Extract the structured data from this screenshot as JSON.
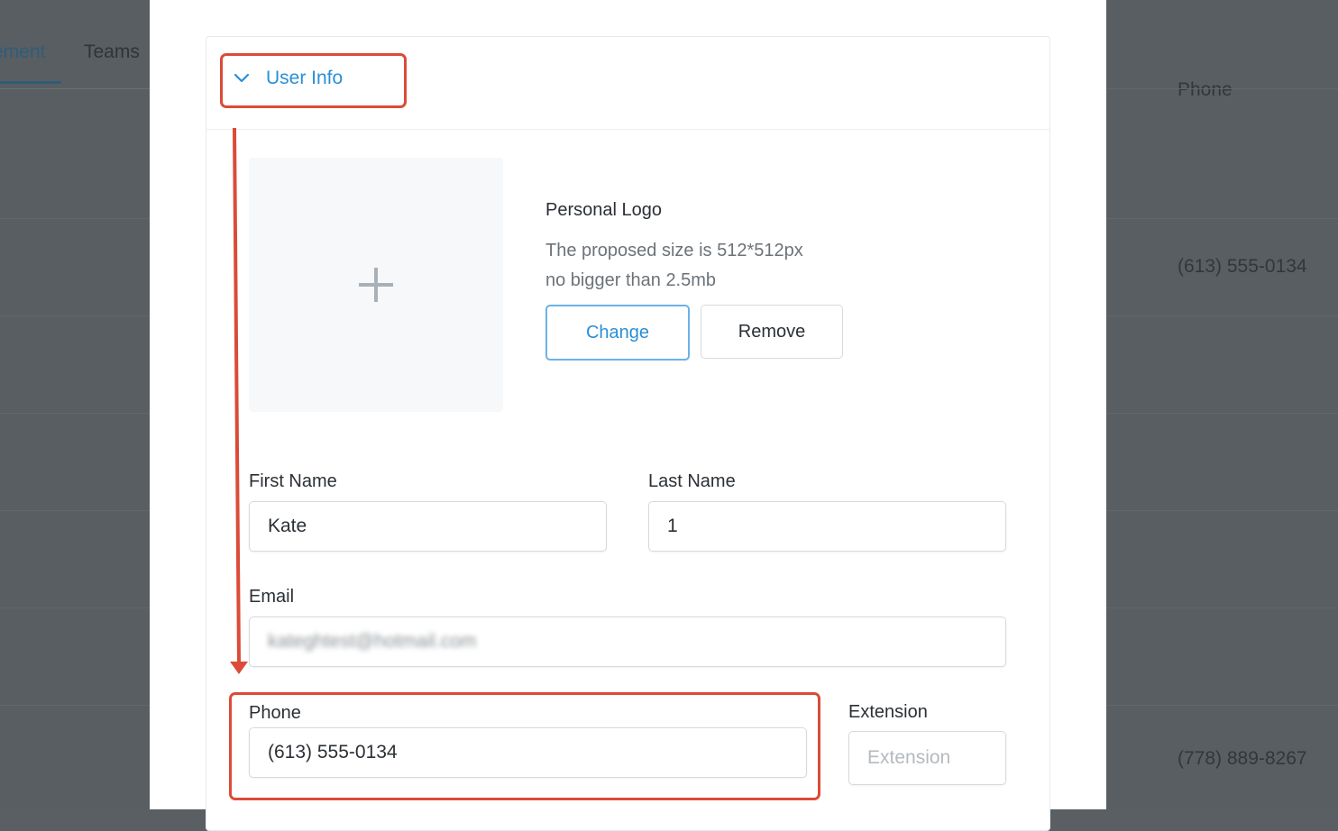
{
  "background": {
    "tabs": [
      {
        "label": "ement"
      },
      {
        "label": "Teams"
      }
    ],
    "column_header": "Phone",
    "phone_values": [
      "(613) 555-0134",
      "(778) 889-8267"
    ]
  },
  "user_info": {
    "section_label": "User Info",
    "logo": {
      "title": "Personal Logo",
      "hint_line1": "The proposed size is 512*512px",
      "hint_line2": "no bigger than 2.5mb",
      "change_label": "Change",
      "remove_label": "Remove",
      "add_icon": "plus-icon"
    },
    "first_name": {
      "label": "First Name",
      "value": "Kate"
    },
    "last_name": {
      "label": "Last Name",
      "value": "1"
    },
    "email": {
      "label": "Email",
      "value": "kateghtest@hotmail.com"
    },
    "phone": {
      "label": "Phone",
      "value": "(613) 555-0134"
    },
    "extension": {
      "label": "Extension",
      "placeholder": "Extension",
      "value": ""
    }
  },
  "colors": {
    "accent": "#2a8fd6",
    "annotation": "#db4b38",
    "overlay": "#595e62"
  }
}
